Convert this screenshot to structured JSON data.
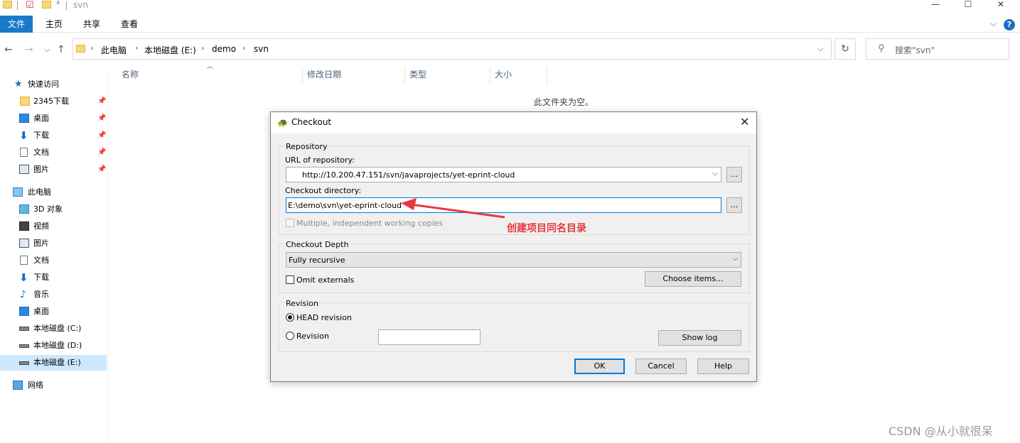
{
  "window": {
    "title": "svn",
    "minimize": "—",
    "maximize": "☐",
    "close": "✕"
  },
  "ribbon": {
    "tabs": [
      "文件",
      "主页",
      "共享",
      "查看"
    ],
    "help": "?",
    "expand": "⌵"
  },
  "nav": {
    "back": "←",
    "forward": "→",
    "recent": "⌵",
    "up": "↑",
    "breadcrumb": [
      "此电脑",
      "本地磁盘 (E:)",
      "demo",
      "svn"
    ],
    "dropdown": "⌵",
    "refresh": "↻",
    "search_placeholder": "搜索\"svn\""
  },
  "sidebar": {
    "quick_access": "快速访问",
    "quick_items": [
      "2345下载",
      "桌面",
      "下载",
      "文档",
      "图片"
    ],
    "this_pc": "此电脑",
    "pc_items": [
      "3D 对象",
      "视频",
      "图片",
      "文档",
      "下载",
      "音乐",
      "桌面",
      "本地磁盘 (C:)",
      "本地磁盘 (D:)",
      "本地磁盘 (E:)"
    ],
    "network": "网络"
  },
  "columns": [
    "名称",
    "修改日期",
    "类型",
    "大小"
  ],
  "empty_message": "此文件夹为空。",
  "dialog": {
    "title": "Checkout",
    "close": "✕",
    "repository_group": "Repository",
    "url_label": "URL of repository:",
    "url_value": "http://10.200.47.151/svn/javaprojects/yet-eprint-cloud",
    "checkout_dir_label": "Checkout directory:",
    "checkout_dir_value": "E:\\demo\\svn\\yet-eprint-cloud",
    "browse": "...",
    "multiple_label": "Multiple, independent working copies",
    "depth_group": "Checkout Depth",
    "depth_value": "Fully recursive",
    "omit_externals": "Omit externals",
    "choose_items": "Choose items...",
    "revision_group": "Revision",
    "head_revision": "HEAD revision",
    "revision": "Revision",
    "revision_value": "",
    "show_log": "Show log",
    "ok": "OK",
    "cancel": "Cancel",
    "help": "Help"
  },
  "annotation": "创建项目同名目录",
  "watermark": "CSDN @从小就很呆",
  "colors": {
    "accent": "#1979ca",
    "annotation": "#e8383d",
    "selected": "#cce8ff"
  }
}
